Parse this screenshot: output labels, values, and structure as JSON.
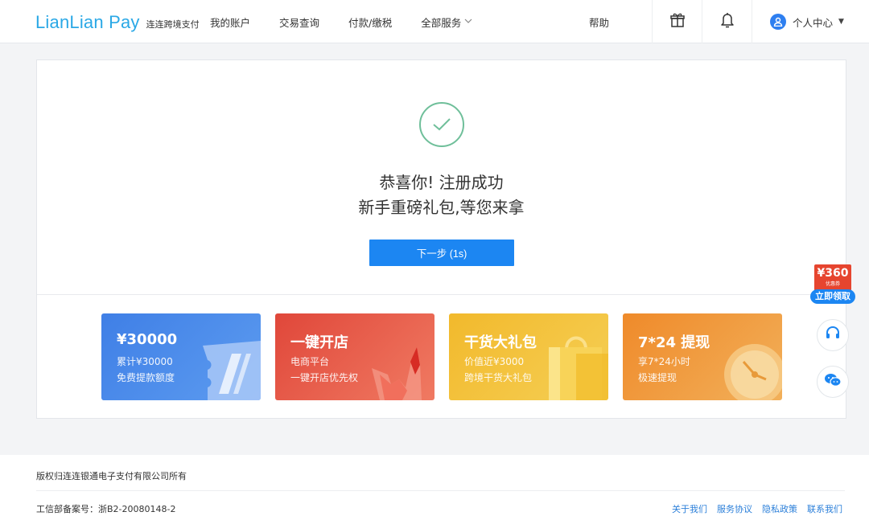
{
  "header": {
    "logo_text": "LianLian Pay",
    "logo_sub": "连连跨境支付",
    "nav": [
      "我的账户",
      "交易查询",
      "付款/缴税",
      "全部服务"
    ],
    "help": "帮助",
    "user_label": "个人中心"
  },
  "success": {
    "line1": "恭喜你! 注册成功",
    "line2": "新手重磅礼包,等您来拿",
    "next_button": "下一步 (1s)"
  },
  "promos": [
    {
      "title": "¥30000",
      "line1": "累计¥30000",
      "line2": "免费提款额度",
      "color": "#4a88ea"
    },
    {
      "title": "一键开店",
      "line1": "电商平台",
      "line2": "一键开店优先权",
      "color": "#e85a47"
    },
    {
      "title": "干货大礼包",
      "line1": "价值近¥3000",
      "line2": "跨境干货大礼包",
      "color": "#f3c33e"
    },
    {
      "title": "7*24 提现",
      "line1": "享7*24小时",
      "line2": "极速提现",
      "color": "#f09a3e"
    }
  ],
  "float": {
    "coupon_amount": "¥360",
    "coupon_sub": "优惠券",
    "coupon_button": "立即领取"
  },
  "footer": {
    "copyright": "版权归连连银通电子支付有限公司所有",
    "icp": "工信部备案号：浙B2-20080148-2",
    "links": [
      "关于我们",
      "服务协议",
      "隐私政策",
      "联系我们"
    ]
  },
  "colors": {
    "brand_blue": "#1c86f2",
    "logo_blue": "#2aa8e6",
    "success_green": "#6fbf9a"
  }
}
